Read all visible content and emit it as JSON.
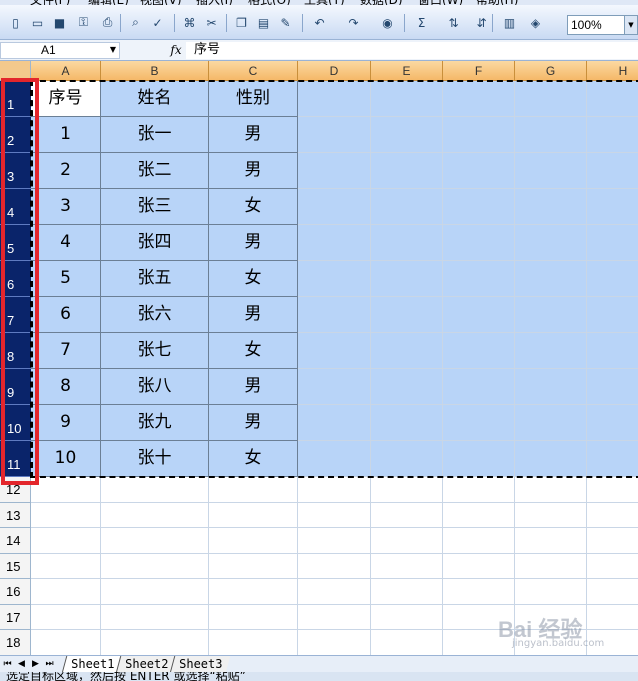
{
  "menu": [
    "文件(F)",
    "编辑(E)",
    "视图(V)",
    "插入(I)",
    "格式(O)",
    "工具(T)",
    "数据(D)",
    "窗口(W)",
    "帮助(H)"
  ],
  "toolbar": {
    "icons": [
      "new-icon",
      "open-icon",
      "save-icon",
      "permission-icon",
      "print-icon",
      "print-preview-icon",
      "spellcheck-icon",
      "research-icon",
      "cut-icon",
      "copy-icon",
      "paste-icon",
      "format-painter-icon",
      "undo-icon",
      "redo-icon",
      "hyperlink-icon",
      "autosum-icon",
      "sort-asc-icon",
      "sort-desc-icon",
      "chart-icon",
      "drawing-icon"
    ],
    "zoom": "100%"
  },
  "formula_bar": {
    "name_box": "A1",
    "fx_label": "fx",
    "content": "序号"
  },
  "columns": [
    "A",
    "B",
    "C",
    "D",
    "E",
    "F",
    "G",
    "H"
  ],
  "rows": [
    "1",
    "2",
    "3",
    "4",
    "5",
    "6",
    "7",
    "8",
    "9",
    "10",
    "11",
    "12",
    "13",
    "14",
    "15",
    "16",
    "17",
    "18"
  ],
  "table": {
    "header": [
      "序号",
      "姓名",
      "性别"
    ],
    "rows": [
      [
        "1",
        "张一",
        "男"
      ],
      [
        "2",
        "张二",
        "男"
      ],
      [
        "3",
        "张三",
        "女"
      ],
      [
        "4",
        "张四",
        "男"
      ],
      [
        "5",
        "张五",
        "女"
      ],
      [
        "6",
        "张六",
        "男"
      ],
      [
        "7",
        "张七",
        "女"
      ],
      [
        "8",
        "张八",
        "男"
      ],
      [
        "9",
        "张九",
        "男"
      ],
      [
        "10",
        "张十",
        "女"
      ]
    ]
  },
  "sheets": [
    "Sheet1",
    "Sheet2",
    "Sheet3"
  ],
  "active_sheet": "Sheet1",
  "status_text": "选定目标区域，然后按 ENTER 或选择“粘贴”",
  "watermark": "Bai 经验",
  "watermark_sub": "jingyan.baidu.com",
  "colors": {
    "selection": "#b8d4f8",
    "row_header_selected": "#0a246a",
    "highlight_box": "#e3262c",
    "column_header": "#f5b868"
  }
}
